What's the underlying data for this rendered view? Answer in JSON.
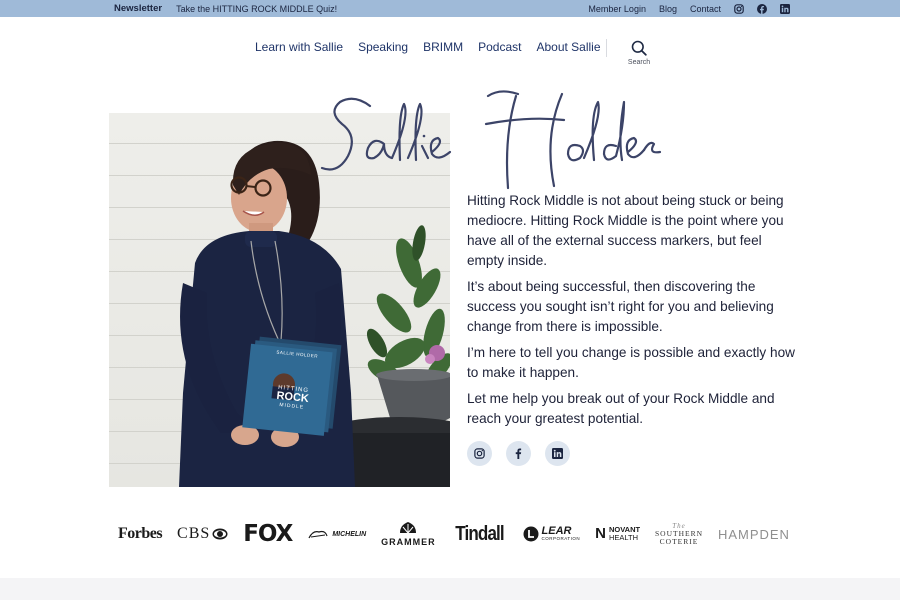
{
  "topbar": {
    "newsletter": "Newsletter",
    "quiz": "Take the HITTING ROCK MIDDLE Quiz!",
    "links": [
      "Member Login",
      "Blog",
      "Contact"
    ],
    "social_icons": [
      "instagram-icon",
      "facebook-icon",
      "linkedin-icon"
    ],
    "bg_color": "#9fbad8"
  },
  "nav": {
    "items": [
      "Learn with Sallie",
      "Speaking",
      "BRIMM",
      "Podcast",
      "About Sallie"
    ],
    "search_label": "Search",
    "text_color": "#1f3468"
  },
  "hero": {
    "signature": "Sallie Holder",
    "book_cover": {
      "author": "SALLIE HOLDER",
      "title_line1": "HITTING",
      "title_line2": "ROCK",
      "title_line3": "MIDDLE"
    },
    "bio": [
      "Hitting Rock Middle is not about being stuck or being mediocre. Hitting Rock Middle is the point where you have all of the external success markers, but feel empty inside.",
      "It’s about being successful, then discovering the success you sought isn’t right for you and believing change from there is impossible.",
      "I’m here to tell you change is possible and exactly how to make it happen.",
      "Let me help you break out of your Rock Middle and reach your greatest potential."
    ],
    "social_icons": [
      "instagram-icon",
      "facebook-icon",
      "linkedin-icon"
    ]
  },
  "logos": {
    "forbes": "Forbes",
    "cbs": "CBS",
    "fox": "FOX",
    "michelin": "MICHELIN",
    "grammer": "GRAMMER",
    "tindall": "Tindall",
    "lear": "LEAR",
    "lear_sub": "CORPORATION",
    "novant_mark": "N",
    "novant_line1": "NOVANT",
    "novant_line2": "HEALTH",
    "southern_the": "The",
    "southern_line1": "SOUTHERN",
    "southern_line2": "COTERIE",
    "hampden": "HAMPDEN"
  }
}
